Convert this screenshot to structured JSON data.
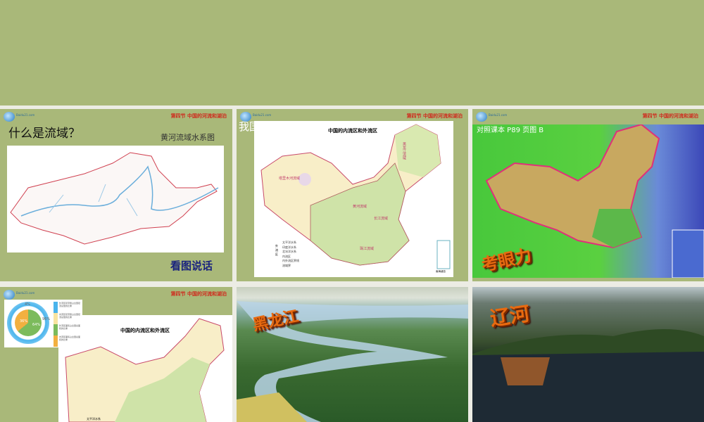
{
  "header_note": "第四节  中国的河流和湖泊",
  "logo_text": "Baidu21.com",
  "slides": [
    {
      "title": "什么是流域？",
      "caption": "黄河流域水系图",
      "footer": "看图说话"
    },
    {
      "title": "我国",
      "map_title": "中国的内流区和外流区",
      "legend": [
        "太平洋水系",
        "印度洋水系",
        "北冰洋水系",
        "内流区",
        "内外流区界线",
        "流域界"
      ],
      "legend_group": "外流区",
      "labels": [
        "塔里木河流域",
        "黑龙江流域",
        "黄河流域",
        "长江流域",
        "珠江流域",
        "南海诸岛"
      ]
    },
    {
      "title": "对照课本 P89 页图 B",
      "overlay": "考眼力"
    },
    {
      "map_title": "中国的内流区和外流区",
      "donut": {
        "outer_pct": [
          "4%",
          "96%"
        ],
        "inner_pct": [
          "36%",
          "64%"
        ],
        "legend": [
          "外流区径流量占全国径流总量的比重",
          "内流区径流量占全国径流总量的比重",
          "外流区面积占全国总面积的比重",
          "内流区面积占全国总面积的比重"
        ]
      },
      "legend_first": "太平洋水系"
    },
    {
      "overlay": "黑龙江"
    },
    {
      "overlay": "辽河"
    }
  ]
}
